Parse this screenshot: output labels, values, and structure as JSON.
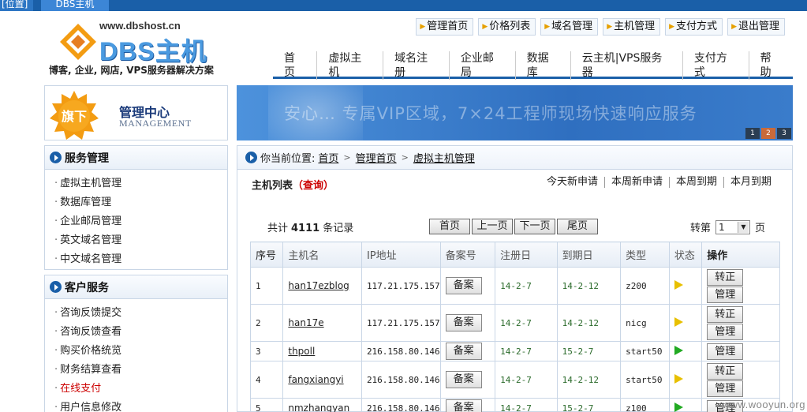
{
  "top_tabs": [
    "[位置]",
    "DBS主机"
  ],
  "logo": {
    "url": "www.dbshost.cn",
    "brand": "DBS主机",
    "slogan": "博客, 企业, 网店, VPS服务器解决方案"
  },
  "top_links": [
    "管理首页",
    "价格列表",
    "域名管理",
    "主机管理",
    "支付方式",
    "退出管理"
  ],
  "main_nav": [
    "首页",
    "虚拟主机",
    "域名注册",
    "企业邮局",
    "数据库",
    "云主机|VPS服务器",
    "支付方式",
    "帮助"
  ],
  "mgmt": {
    "badge": "旗下",
    "title": "管理中心",
    "subtitle": "MANAGEMENT"
  },
  "service_panel": {
    "title": "服务管理",
    "items": [
      "虚拟主机管理",
      "数据库管理",
      "企业邮局管理",
      "英文域名管理",
      "中文域名管理"
    ]
  },
  "customer_panel": {
    "title": "客户服务",
    "items": [
      "咨询反馈提交",
      "咨询反馈查看",
      "购买价格统览",
      "财务结算查看",
      "在线支付",
      "用户信息修改"
    ]
  },
  "banner": {
    "text": "安心…        专属VIP区域，7×24工程师现场快速响应服务",
    "dots": [
      "1",
      "2",
      "3"
    ]
  },
  "breadcrumb": {
    "prefix": "你当前位置:",
    "items": [
      "首页",
      "管理首页",
      "虚拟主机管理"
    ]
  },
  "list": {
    "title": "主机列表",
    "query": "（查询）"
  },
  "filters": [
    "今天新申请",
    "本周新申请",
    "本周到期",
    "本月到期"
  ],
  "total": {
    "prefix": "共计",
    "count": "4111",
    "suffix": "条记录"
  },
  "pager": [
    "首页",
    "上一页",
    "下一页",
    "尾页"
  ],
  "goto": {
    "prefix": "转第",
    "value": "1",
    "suffix": "页"
  },
  "table": {
    "headers": [
      "序号",
      "主机名",
      "IP地址",
      "备案号",
      "注册日",
      "到期日",
      "类型",
      "状态",
      "操作"
    ],
    "record_label": "备案",
    "rows": [
      {
        "no": "1",
        "name": "han17ezblog",
        "ip": "117.21.175.157",
        "reg": "14-2-7",
        "exp": "14-2-12",
        "type": "z200",
        "status": "yellow",
        "ops": [
          "转正",
          "管理"
        ]
      },
      {
        "no": "2",
        "name": "han17e",
        "ip": "117.21.175.157",
        "reg": "14-2-7",
        "exp": "14-2-12",
        "type": "nicg",
        "status": "yellow",
        "ops": [
          "转正",
          "管理"
        ]
      },
      {
        "no": "3",
        "name": "thpoll",
        "ip": "216.158.80.146",
        "reg": "14-2-7",
        "exp": "15-2-7",
        "type": "start50",
        "status": "green",
        "ops": [
          "管理"
        ]
      },
      {
        "no": "4",
        "name": "fangxiangyi",
        "ip": "216.158.80.146",
        "reg": "14-2-7",
        "exp": "14-2-12",
        "type": "start50",
        "status": "yellow",
        "ops": [
          "转正",
          "管理"
        ]
      },
      {
        "no": "5",
        "name": "nmzhangyan",
        "ip": "216.158.80.146",
        "reg": "14-2-7",
        "exp": "15-2-7",
        "type": "z100",
        "status": "green",
        "ops": [
          "管理"
        ]
      }
    ]
  },
  "watermark": "www.wooyun.org",
  "colors": {
    "brand_blue": "#1a5fa8",
    "accent_orange": "#f39c12",
    "status_yellow": "#e8c000",
    "status_green": "#22aa22",
    "alert_red": "#cc0000"
  }
}
